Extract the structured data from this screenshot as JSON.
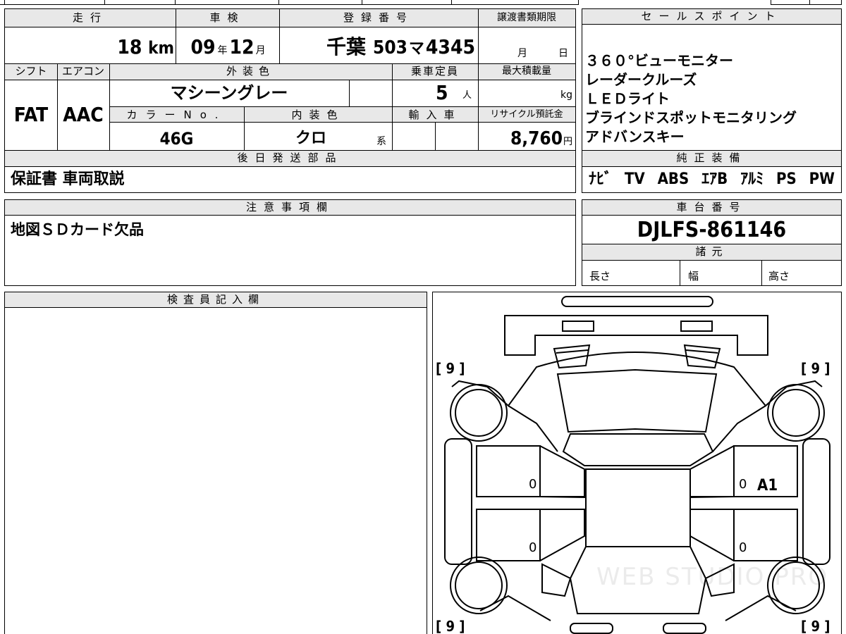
{
  "header": {
    "mileage_label": "走行",
    "inspection_label": "車検",
    "registration_label": "登録番号",
    "transfer_label": "譲渡書類期限",
    "sales_points_label": "セールスポイント"
  },
  "vehicle": {
    "mileage": "18",
    "mileage_unit": "km",
    "inspection_year": "09",
    "year_unit": "年",
    "inspection_month": "12",
    "month_unit": "月",
    "plate_region": "千葉",
    "plate_number": "503",
    "plate_kana": "マ",
    "plate_serial": "4345",
    "transfer_month_unit": "月",
    "transfer_day_unit": "日"
  },
  "row2": {
    "shift_label": "シフト",
    "ac_label": "エアコン",
    "exterior_label": "外装色",
    "capacity_label": "乗車定員",
    "max_load_label": "最大積載量",
    "shift": "FAT",
    "ac": "AAC",
    "exterior_color": "マシーングレー",
    "capacity": "5",
    "capacity_unit": "人",
    "load_unit": "kg",
    "color_no_label": "カラーNo.",
    "interior_label": "内装色",
    "import_label": "輸入車",
    "recycle_label": "リサイクル預託金",
    "color_no": "46G",
    "interior_color": "クロ",
    "interior_suffix": "系",
    "recycle_fee": "8,760",
    "recycle_unit": "円"
  },
  "sales_points": [
    "３６０°ビューモニター",
    "レーダークルーズ",
    "ＬＥＤライト",
    "ブラインドスポットモニタリング",
    "アドバンスキー"
  ],
  "later_parts": {
    "label": "後日発送部品",
    "value": "保証書 車両取説"
  },
  "equipment": {
    "label": "純正装備",
    "items": [
      "ﾅﾋﾞ",
      "TV",
      "ABS",
      "ｴｱB",
      "ｱﾙﾐ",
      "PS",
      "PW"
    ]
  },
  "notes": {
    "label": "注意事項欄",
    "value": "地図ＳＤカード欠品"
  },
  "chassis": {
    "label": "車台番号",
    "value": "DJLFS-861146",
    "specs_label": "諸元",
    "length_label": "長さ",
    "width_label": "幅",
    "height_label": "高さ"
  },
  "inspector": {
    "label": "検査員記入欄"
  },
  "diagram": {
    "tire_tl": "[ 9 ]",
    "tire_tr": "[ 9 ]",
    "tire_bl": "[ 9 ]",
    "tire_br": "[ 9 ]",
    "door_fl": "0",
    "door_fr": "0",
    "door_rl": "0",
    "door_rr": "0",
    "damage_code": "A1",
    "watermark": "WEB STUDIO PRO"
  }
}
